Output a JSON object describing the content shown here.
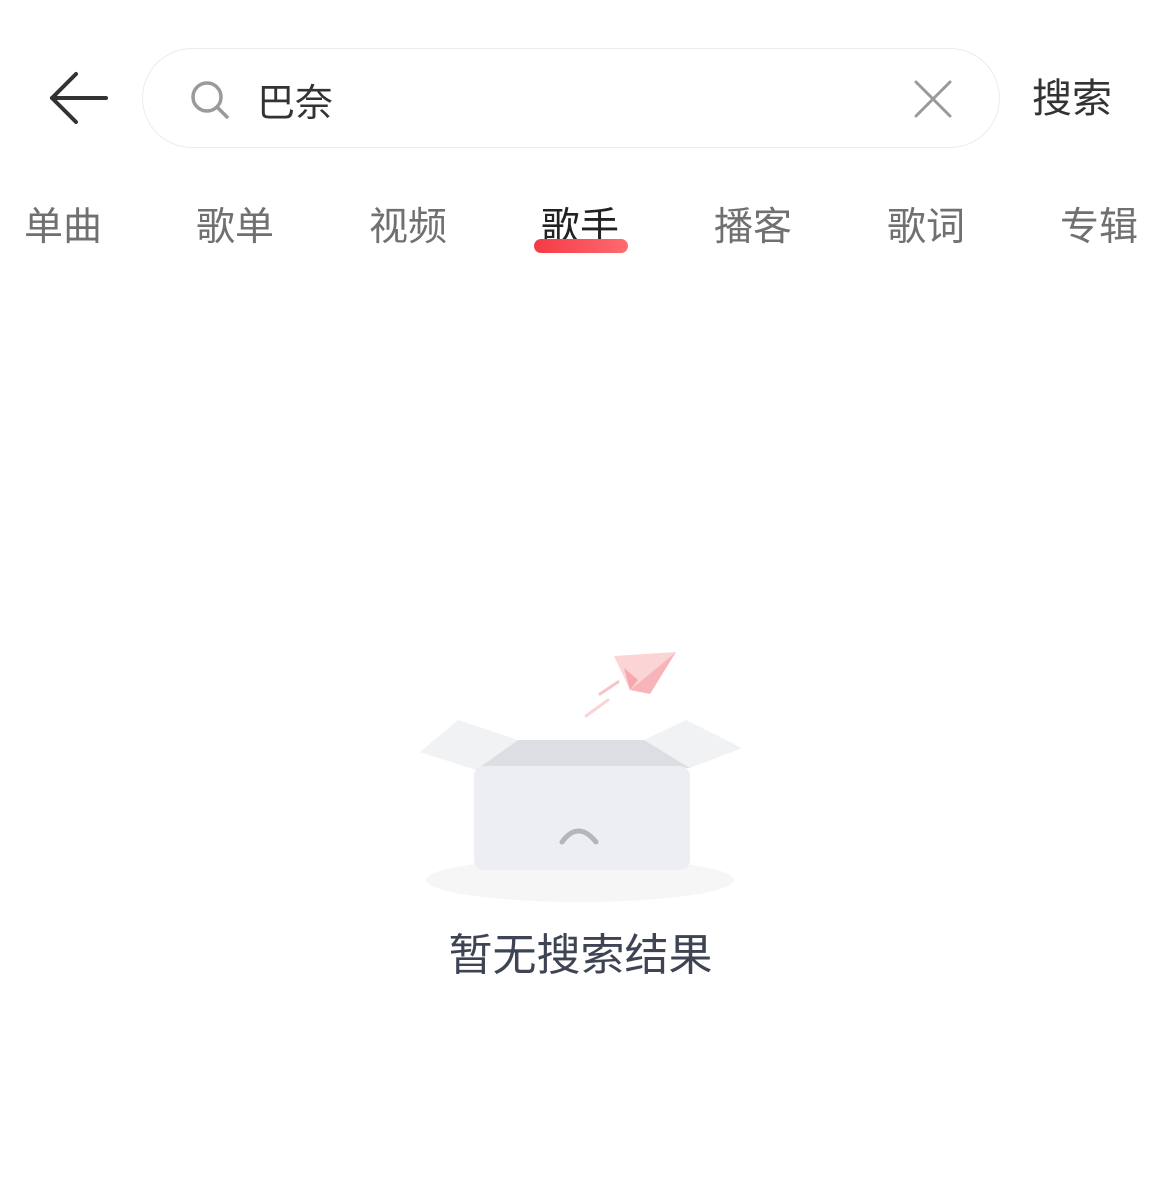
{
  "header": {
    "back_icon": "arrow-left-icon",
    "search": {
      "icon": "search-icon",
      "query": "巴奈",
      "clear_icon": "close-icon"
    },
    "submit_label": "搜索"
  },
  "tabs": [
    {
      "label": "单曲",
      "active": false
    },
    {
      "label": "歌单",
      "active": false
    },
    {
      "label": "视频",
      "active": false
    },
    {
      "label": "歌手",
      "active": true
    },
    {
      "label": "播客",
      "active": false
    },
    {
      "label": "歌词",
      "active": false
    },
    {
      "label": "专辑",
      "active": false
    }
  ],
  "empty_state": {
    "illustration": "empty-box-paper-plane-icon",
    "message": "暂无搜索结果"
  },
  "colors": {
    "accent": "#f33b45",
    "text_primary": "#333333",
    "text_secondary": "#707070",
    "empty_text": "#3e4454"
  }
}
